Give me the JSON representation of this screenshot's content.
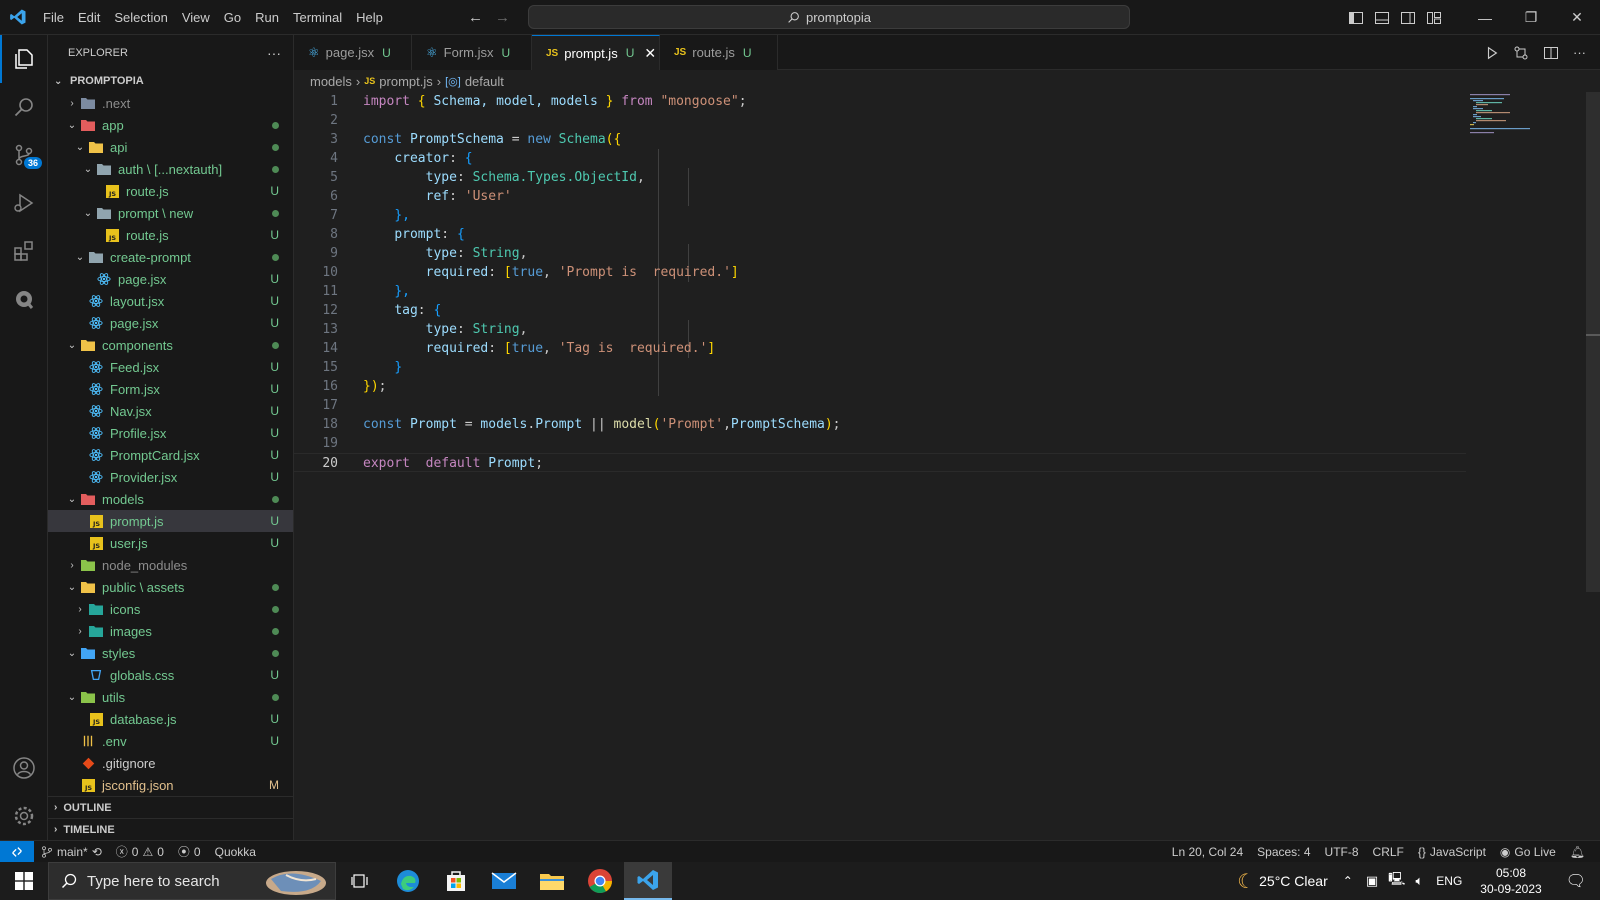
{
  "titlebar": {
    "menu": [
      "File",
      "Edit",
      "Selection",
      "View",
      "Go",
      "Run",
      "Terminal",
      "Help"
    ],
    "search_text": "promptopia"
  },
  "activity": {
    "scm_badge": "36"
  },
  "sidebar": {
    "title": "EXPLORER",
    "more": "···",
    "project": "PROMPTOPIA",
    "tree": [
      {
        "label": ".next",
        "chev": "›",
        "icon": "folder-next-icon",
        "status": ""
      },
      {
        "label": "app",
        "chev": "⌄",
        "icon": "folder-app-icon",
        "status": "dot"
      },
      {
        "label": "api",
        "chev": "⌄",
        "icon": "folder-api-icon",
        "status": "dot"
      },
      {
        "label": "auth \\ [...nextauth]",
        "chev": "⌄",
        "icon": "folder-open-icon",
        "status": "dot"
      },
      {
        "label": "route.js",
        "chev": "",
        "icon": "js-file-icon",
        "status": "U"
      },
      {
        "label": "prompt \\ new",
        "chev": "⌄",
        "icon": "folder-open-icon",
        "status": "dot"
      },
      {
        "label": "route.js",
        "chev": "",
        "icon": "js-file-icon",
        "status": "U"
      },
      {
        "label": "create-prompt",
        "chev": "⌄",
        "icon": "folder-open-icon",
        "status": "dot"
      },
      {
        "label": "page.jsx",
        "chev": "",
        "icon": "react-file-icon",
        "status": "U"
      },
      {
        "label": "layout.jsx",
        "chev": "",
        "icon": "react-file-icon",
        "status": "U"
      },
      {
        "label": "page.jsx",
        "chev": "",
        "icon": "react-file-icon",
        "status": "U"
      },
      {
        "label": "components",
        "chev": "⌄",
        "icon": "folder-components-icon",
        "status": "dot"
      },
      {
        "label": "Feed.jsx",
        "chev": "",
        "icon": "react-file-icon",
        "status": "U"
      },
      {
        "label": "Form.jsx",
        "chev": "",
        "icon": "react-file-icon",
        "status": "U"
      },
      {
        "label": "Nav.jsx",
        "chev": "",
        "icon": "react-file-icon",
        "status": "U"
      },
      {
        "label": "Profile.jsx",
        "chev": "",
        "icon": "react-file-icon",
        "status": "U"
      },
      {
        "label": "PromptCard.jsx",
        "chev": "",
        "icon": "react-file-icon",
        "status": "U"
      },
      {
        "label": "Provider.jsx",
        "chev": "",
        "icon": "react-file-icon",
        "status": "U"
      },
      {
        "label": "models",
        "chev": "⌄",
        "icon": "folder-models-icon",
        "status": "dot"
      },
      {
        "label": "prompt.js",
        "chev": "",
        "icon": "js-file-icon",
        "status": "U"
      },
      {
        "label": "user.js",
        "chev": "",
        "icon": "js-file-icon",
        "status": "U"
      },
      {
        "label": "node_modules",
        "chev": "›",
        "icon": "folder-node-icon",
        "status": ""
      },
      {
        "label": "public \\ assets",
        "chev": "⌄",
        "icon": "folder-public-icon",
        "status": "dot"
      },
      {
        "label": "icons",
        "chev": "›",
        "icon": "folder-images-icon",
        "status": "dot"
      },
      {
        "label": "images",
        "chev": "›",
        "icon": "folder-images-icon",
        "status": "dot"
      },
      {
        "label": "styles",
        "chev": "⌄",
        "icon": "folder-styles-icon",
        "status": "dot"
      },
      {
        "label": "globals.css",
        "chev": "",
        "icon": "css-file-icon",
        "status": "U"
      },
      {
        "label": "utils",
        "chev": "⌄",
        "icon": "folder-utils-icon",
        "status": "dot"
      },
      {
        "label": "database.js",
        "chev": "",
        "icon": "js-file-icon",
        "status": "U"
      },
      {
        "label": ".env",
        "chev": "",
        "icon": "env-file-icon",
        "status": "U"
      },
      {
        "label": ".gitignore",
        "chev": "",
        "icon": "git-file-icon",
        "status": ""
      },
      {
        "label": "jsconfig.json",
        "chev": "",
        "icon": "json-file-icon",
        "status": "M"
      }
    ],
    "outline": "OUTLINE",
    "timeline": "TIMELINE"
  },
  "tabs": [
    {
      "label": "page.jsx",
      "status": "U",
      "icon": "react"
    },
    {
      "label": "Form.jsx",
      "status": "U",
      "icon": "react"
    },
    {
      "label": "prompt.js",
      "status": "U",
      "icon": "js"
    },
    {
      "label": "route.js",
      "status": "U",
      "icon": "js"
    }
  ],
  "breadcrumb": {
    "folder": "models",
    "file": "prompt.js",
    "symbol": "default"
  },
  "editor": {
    "line_numbers": [
      "1",
      "2",
      "3",
      "4",
      "5",
      "6",
      "7",
      "8",
      "9",
      "10",
      "11",
      "12",
      "13",
      "14",
      "15",
      "16",
      "17",
      "18",
      "19",
      "20"
    ],
    "code": {
      "l1_import": "import",
      "l1_ob": "{",
      "l1_names": " Schema, model, models ",
      "l1_cb": "}",
      "l1_from": " from ",
      "l1_str": "\"mongoose\"",
      "l1_end": ";",
      "l3_const": "const",
      "l3_name": " PromptSchema ",
      "l3_eq": "= ",
      "l3_new": "new",
      "l3_schema": " Schema",
      "l3_open": "({",
      "l4_key": "creator",
      "l4_colon": ": ",
      "l4_open": "{",
      "l5_key": "type",
      "l5_val": "Schema.Types.ObjectId",
      "l5_comma": ",",
      "l6_key": "ref",
      "l6_str": "'User'",
      "l7_close": "},",
      "l8_key": "prompt",
      "l8_open": "{",
      "l9_key": "type",
      "l9_val": "String",
      "l9_comma": ",",
      "l10_key": "required",
      "l10_ob": "[",
      "l10_true": "true",
      "l10_comma": ", ",
      "l10_str": "'Prompt is  required.'",
      "l10_cb": "]",
      "l11_close": "},",
      "l12_key": "tag",
      "l12_open": "{",
      "l13_key": "type",
      "l13_val": "String",
      "l13_comma": ",",
      "l14_key": "required",
      "l14_ob": "[",
      "l14_true": "true",
      "l14_comma": ", ",
      "l14_str": "'Tag is  required.'",
      "l14_cb": "]",
      "l15_close": "}",
      "l16_close": "})",
      "l16_semi": ";",
      "l18_const": "const",
      "l18_name": " Prompt ",
      "l18_eq": "= ",
      "l18_models": "models",
      "l18_dot": ".",
      "l18_prompt": "Prompt",
      "l18_or": " || ",
      "l18_model": "model",
      "l18_open": "(",
      "l18_str": "'Prompt'",
      "l18_comma": ",",
      "l18_schema": "PromptSchema",
      "l18_close": ")",
      "l18_semi": ";",
      "l20_export": "export",
      "l20_default": "  default",
      "l20_name": " Prompt",
      "l20_semi": ";"
    }
  },
  "statusbar": {
    "branch": "main*",
    "errors": "0",
    "warnings": "0",
    "ports": "0",
    "quokka": "Quokka",
    "position": "Ln 20, Col 24",
    "spaces": "Spaces: 4",
    "encoding": "UTF-8",
    "eol": "CRLF",
    "language": "JavaScript",
    "golive": "Go Live"
  },
  "taskbar": {
    "search_placeholder": "Type here to search",
    "weather": "25°C  Clear",
    "lang": "ENG",
    "time": "05:08",
    "date": "30-09-2023"
  },
  "colors": {
    "accent": "#0078d4",
    "git_untracked": "#73c991",
    "git_modified": "#e2c08d",
    "editor_bg": "#1f1f1f",
    "sidebar_bg": "#181818"
  }
}
